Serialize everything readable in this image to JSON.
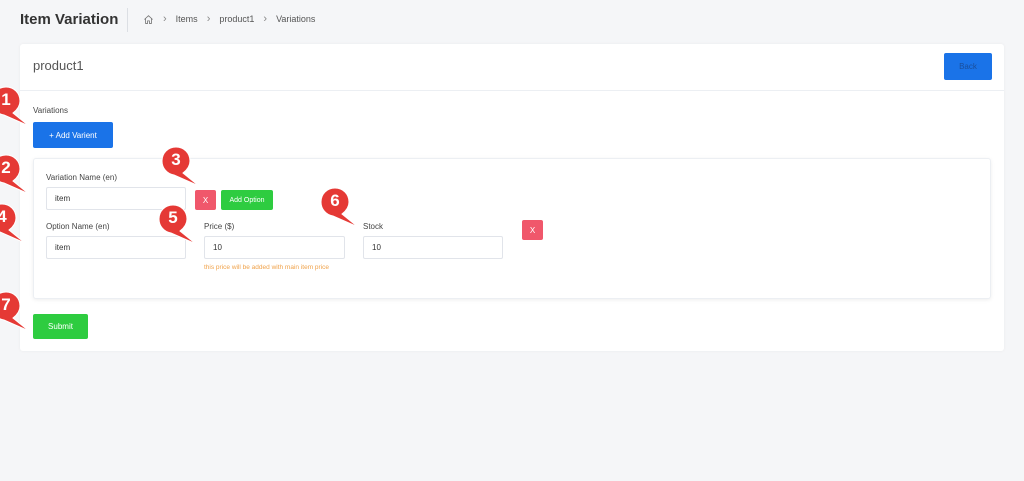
{
  "header": {
    "title": "Item Variation",
    "breadcrumb": [
      "Items",
      "product1",
      "Variations"
    ],
    "home_icon": "home-icon"
  },
  "card": {
    "title": "product1",
    "back_label": "Back"
  },
  "variations": {
    "label": "Variations",
    "add_button": "+ Add Varient",
    "variation_name_label": "Variation Name (en)",
    "variation_name_value": "item",
    "remove_label": "X",
    "add_option_label": "Add Option",
    "option": {
      "name_label": "Option Name (en)",
      "name_value": "item",
      "price_label": "Price ($)",
      "price_value": "10",
      "price_hint": "this price will be added with main item price",
      "stock_label": "Stock",
      "stock_value": "10",
      "remove_label": "X"
    }
  },
  "submit_label": "Submit",
  "markers": [
    "1",
    "2",
    "3",
    "4",
    "5",
    "6",
    "7"
  ],
  "colors": {
    "primary": "#1a73e8",
    "success": "#2ecc40",
    "danger": "#f0576b",
    "hint": "#f0a24a",
    "marker": "#e53935"
  }
}
